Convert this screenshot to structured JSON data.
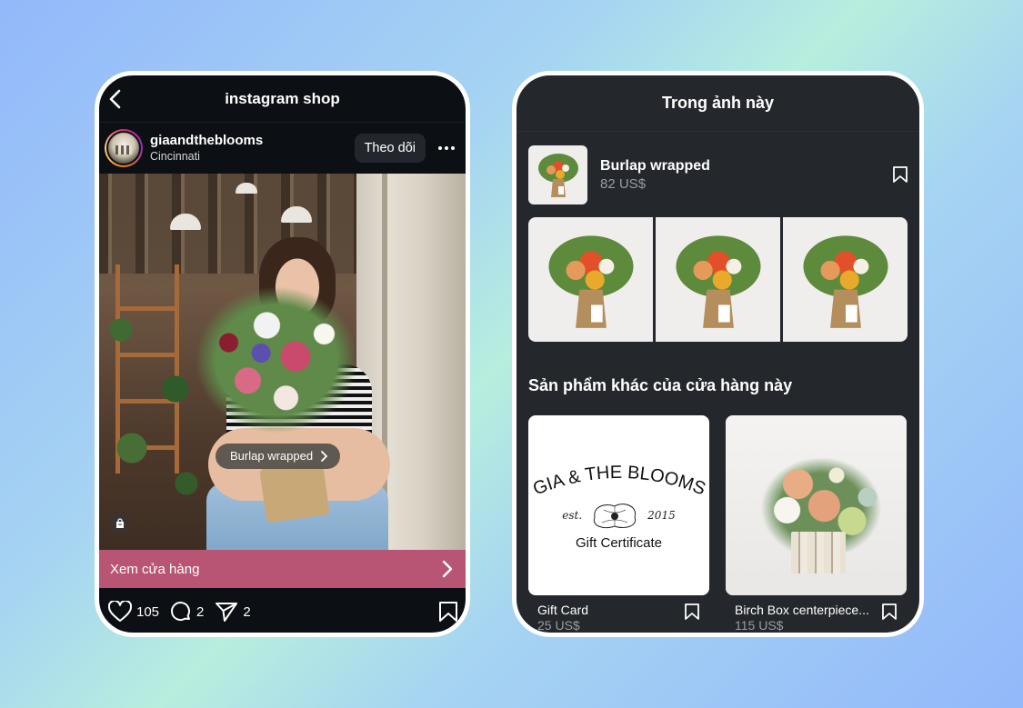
{
  "left_phone": {
    "header": {
      "title": "instagram shop",
      "back_icon": "chevron-left-icon"
    },
    "post": {
      "username": "giaandtheblooms",
      "location": "Cincinnati",
      "follow_label": "Theo dõi",
      "more_icon": "ellipsis-icon",
      "product_tag": "Burlap wrapped",
      "shop_badge_icon": "shopping-bag-icon"
    },
    "shop_bar": {
      "label": "Xem cửa hàng",
      "icon": "chevron-right-icon"
    },
    "actions": {
      "likes": "105",
      "comments": "2",
      "shares": "2"
    }
  },
  "right_phone": {
    "header": {
      "title": "Trong ảnh này"
    },
    "tagged_product": {
      "name": "Burlap wrapped",
      "price": "82 US$"
    },
    "section_title": "Sản phẩm khác của cửa hàng này",
    "products": [
      {
        "name": "Gift Card",
        "price": "25 US$",
        "image": {
          "title": "GIA & THE BLOOMS",
          "est_left": "est.",
          "est_right": "2015",
          "subtitle": "Gift Certificate"
        }
      },
      {
        "name": "Birch Box centerpiece...",
        "price": "115 US$"
      }
    ]
  },
  "colors": {
    "shop_bar": "#b85474",
    "left_bg": "#0c0f13",
    "right_bg": "#24272c"
  }
}
